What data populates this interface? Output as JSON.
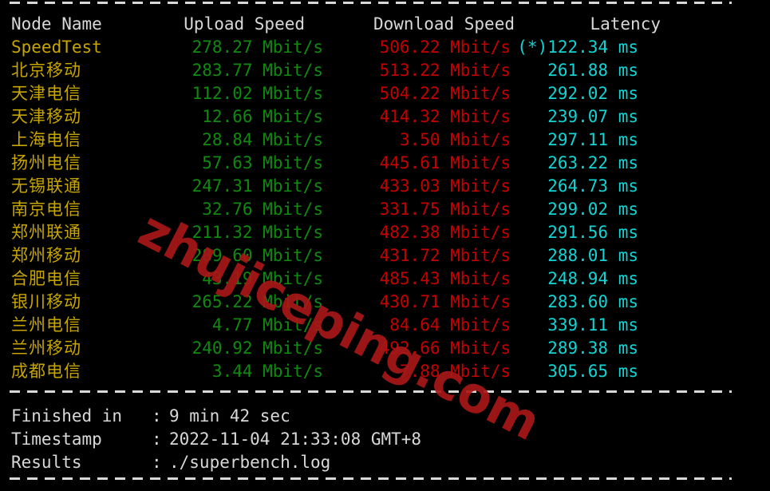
{
  "terminal": {
    "background": "#000000",
    "separator_color": "#d8d8d8",
    "colors": {
      "header": "#d8d8d8",
      "node": "#c7a500",
      "upload": "#0f8a0f",
      "download": "#c40000",
      "latency": "#13d4d4",
      "watermark": "#a81717"
    }
  },
  "table": {
    "headers": {
      "node": "Node Name",
      "upload": "Upload Speed",
      "download": "Download Speed",
      "latency": "Latency"
    },
    "rows": [
      {
        "node": "SpeedTest",
        "upload": "278.27 Mbit/s",
        "download": "506.22 Mbit/s",
        "latency": "(*)122.34 ms"
      },
      {
        "node": "北京移动",
        "upload": "283.77 Mbit/s",
        "download": "513.22 Mbit/s",
        "latency": "261.88 ms"
      },
      {
        "node": "天津电信",
        "upload": "112.02 Mbit/s",
        "download": "504.22 Mbit/s",
        "latency": "292.02 ms"
      },
      {
        "node": "天津移动",
        "upload": "12.66 Mbit/s",
        "download": "414.32 Mbit/s",
        "latency": "239.07 ms"
      },
      {
        "node": "上海电信",
        "upload": "28.84 Mbit/s",
        "download": "3.50 Mbit/s",
        "latency": "297.11 ms"
      },
      {
        "node": "扬州电信",
        "upload": "57.63 Mbit/s",
        "download": "445.61 Mbit/s",
        "latency": "263.22 ms"
      },
      {
        "node": "无锡联通",
        "upload": "247.31 Mbit/s",
        "download": "433.03 Mbit/s",
        "latency": "264.73 ms"
      },
      {
        "node": "南京电信",
        "upload": "32.76 Mbit/s",
        "download": "331.75 Mbit/s",
        "latency": "299.02 ms"
      },
      {
        "node": "郑州联通",
        "upload": "211.32 Mbit/s",
        "download": "482.38 Mbit/s",
        "latency": "291.56 ms"
      },
      {
        "node": "郑州移动",
        "upload": "289.60 Mbit/s",
        "download": "431.72 Mbit/s",
        "latency": "288.01 ms"
      },
      {
        "node": "合肥电信",
        "upload": "43.19 Mbit/s",
        "download": "485.43 Mbit/s",
        "latency": "248.94 ms"
      },
      {
        "node": "银川移动",
        "upload": "265.22 Mbit/s",
        "download": "430.71 Mbit/s",
        "latency": "283.60 ms"
      },
      {
        "node": "兰州电信",
        "upload": "4.77 Mbit/s",
        "download": "84.64 Mbit/s",
        "latency": "339.11 ms"
      },
      {
        "node": "兰州移动",
        "upload": "240.92 Mbit/s",
        "download": "492.66 Mbit/s",
        "latency": "289.38 ms"
      },
      {
        "node": "成都电信",
        "upload": "3.44 Mbit/s",
        "download": "7.88 Mbit/s",
        "latency": "305.65 ms"
      }
    ]
  },
  "summary": [
    {
      "label": "Finished in",
      "colon": ":",
      "value": "9 min 42 sec"
    },
    {
      "label": "Timestamp",
      "colon": ":",
      "value": "2022-11-04 21:33:08 GMT+8"
    },
    {
      "label": "Results",
      "colon": ":",
      "value": "./superbench.log"
    }
  ],
  "watermark": {
    "text": "zhujiceping.com"
  }
}
